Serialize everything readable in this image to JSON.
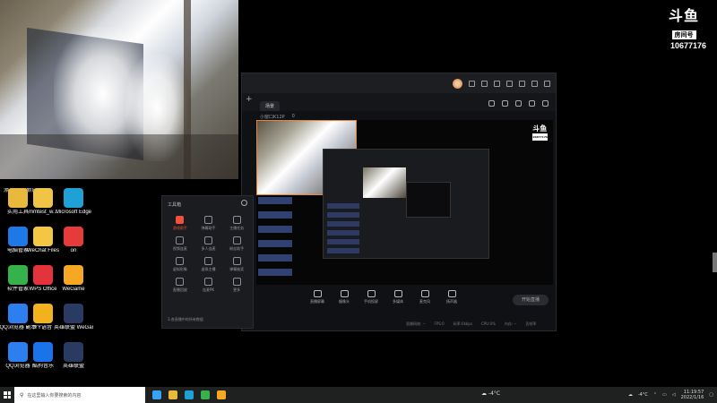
{
  "overlay": {
    "logo_mark": "斗鱼",
    "logo_tag": "房间号",
    "room_id": "10677176"
  },
  "desktop_icons": [
    {
      "label": "添加/删除新应用",
      "color": "#f5c542"
    },
    {
      "label": "实用工具",
      "color": "#e8b93a"
    },
    {
      "label": "mmtest_w...",
      "color": "#f0c446"
    },
    {
      "label": "Microsoft Edge",
      "color": "#1fa1d6"
    },
    {
      "label": "电脑管家",
      "color": "#1e78e8"
    },
    {
      "label": "WeChat Files",
      "color": "#f3c744"
    },
    {
      "label": "on",
      "color": "#e63b3b"
    },
    {
      "label": "软件管家",
      "color": "#36b24a"
    },
    {
      "label": "WPS Office",
      "color": "#e4343b"
    },
    {
      "label": "WeGame",
      "color": "#f6a825"
    },
    {
      "label": "QQ浏览器 副本",
      "color": "#2d7ff0"
    },
    {
      "label": "YY语音",
      "color": "#f1b21d"
    },
    {
      "label": "英雄联盟 WeGame版",
      "color": "#2a3b63"
    },
    {
      "label": "QQ浏览器",
      "color": "#2d7ff0"
    },
    {
      "label": "酷狗音乐",
      "color": "#1a73e8"
    },
    {
      "label": "英雄联盟",
      "color": "#2a3b63"
    }
  ],
  "app": {
    "tab_label": "场景",
    "sub_items": [
      "小窗口K12P",
      "0"
    ],
    "tool_panel": {
      "title": "工具箱",
      "items": [
        {
          "label": "游戏助手",
          "hot": true
        },
        {
          "label": "弹幕助手",
          "hot": false
        },
        {
          "label": "主播任务",
          "hot": false
        },
        {
          "label": "视频连麦",
          "hot": false
        },
        {
          "label": "多人连麦",
          "hot": false
        },
        {
          "label": "粉丝助手",
          "hot": false
        },
        {
          "label": "虚拟形象",
          "hot": false
        },
        {
          "label": "虚拟主播",
          "hot": false
        },
        {
          "label": "弹幕抽奖",
          "hot": false
        },
        {
          "label": "直播回放",
          "hot": false
        },
        {
          "label": "连麦PK",
          "hot": false
        },
        {
          "label": "更多",
          "hot": false
        }
      ],
      "footer": "3.各直播中的所有数据"
    },
    "controls": [
      "直播屏幕",
      "摄像头",
      "手机投屏",
      "多媒体",
      "麦克风",
      "扬声器"
    ],
    "start_label": "开始直播",
    "status": [
      "直播网络: --",
      "FPS:0",
      "码率:0kbps",
      "CPU:0%",
      "内存: --",
      "丢帧率"
    ]
  },
  "taskbar": {
    "search_placeholder": "在这里输入你要搜索的内容",
    "weather": "-4°C",
    "time": "11:19:57",
    "date": "2022/1/16",
    "app_colors": [
      "#38a3f1",
      "#e8b93a",
      "#1fa1d6",
      "#36b24a",
      "#f6a825"
    ]
  }
}
